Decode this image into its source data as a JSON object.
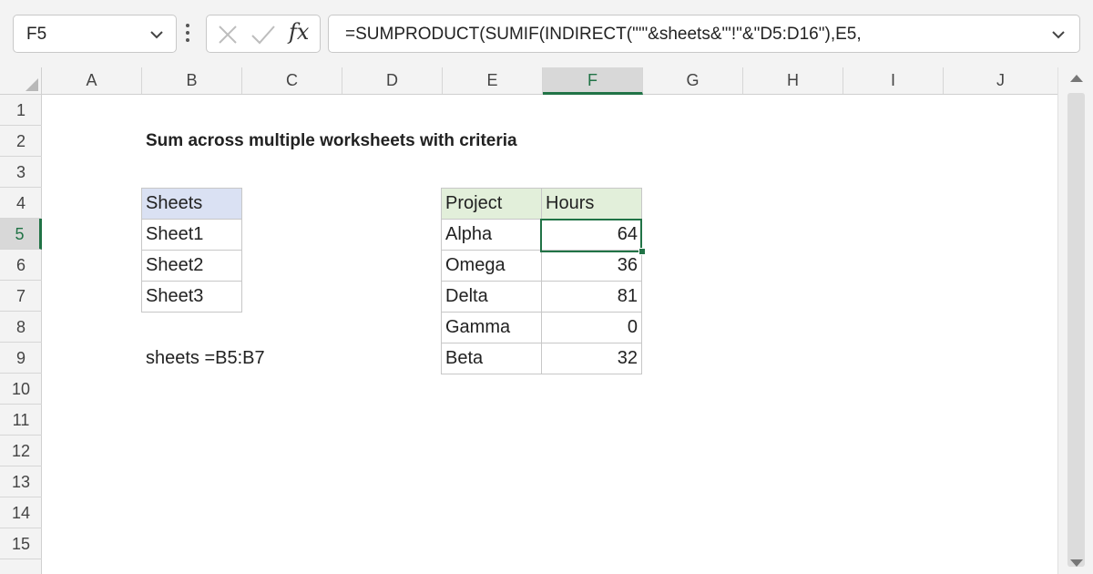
{
  "formula_bar": {
    "name_box": "F5",
    "formula": "=SUMPRODUCT(SUMIF(INDIRECT(\"'\"&sheets&\"'!\"&\"D5:D16\"),E5,",
    "fx_label": "fx"
  },
  "columns": [
    "A",
    "B",
    "C",
    "D",
    "E",
    "F",
    "G",
    "H",
    "I",
    "J"
  ],
  "selected_column": "F",
  "rows": [
    "1",
    "2",
    "3",
    "4",
    "5",
    "6",
    "7",
    "8",
    "9",
    "10",
    "11",
    "12",
    "13",
    "14",
    "15"
  ],
  "selected_row": "5",
  "sheet": {
    "title": "Sum across multiple worksheets with criteria",
    "sheets_table": {
      "header": "Sheets",
      "items": [
        "Sheet1",
        "Sheet2",
        "Sheet3"
      ]
    },
    "named_range_note": "sheets =B5:B7",
    "project_table": {
      "headers": [
        "Project",
        "Hours"
      ],
      "rows": [
        {
          "project": "Alpha",
          "hours": "64"
        },
        {
          "project": "Omega",
          "hours": "36"
        },
        {
          "project": "Delta",
          "hours": "81"
        },
        {
          "project": "Gamma",
          "hours": "0"
        },
        {
          "project": "Beta",
          "hours": "32"
        }
      ]
    }
  },
  "colors": {
    "accent_green": "#217346",
    "sheets_header_fill": "#dae1f3",
    "project_header_fill": "#e2efda"
  }
}
